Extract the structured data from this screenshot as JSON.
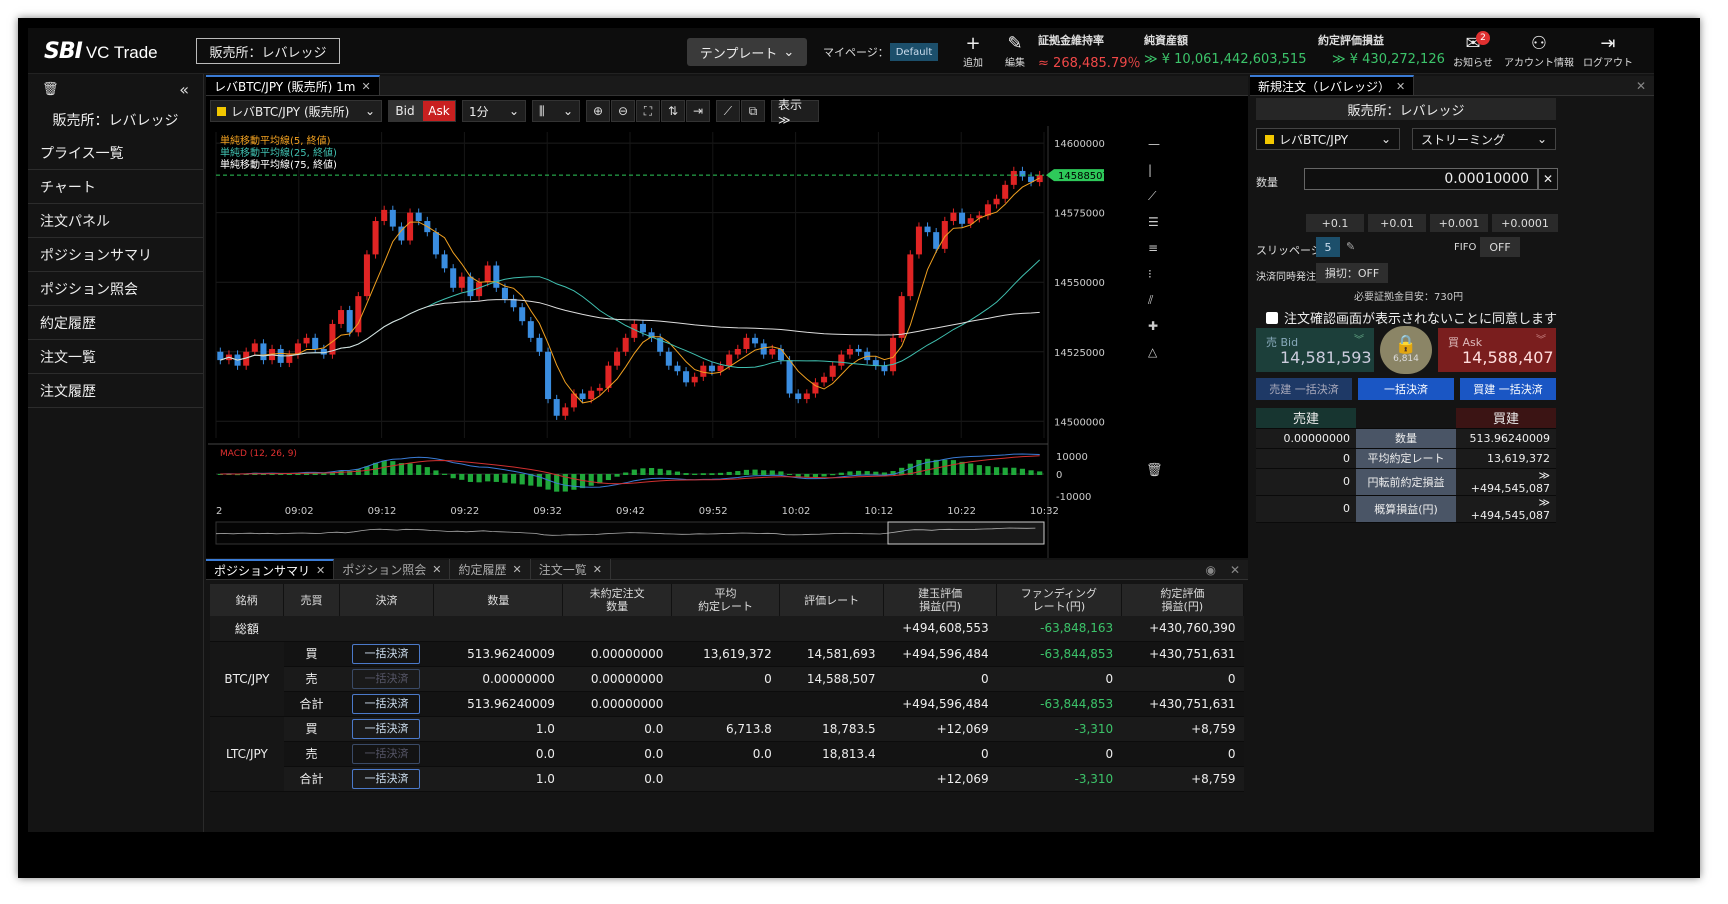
{
  "header": {
    "logo_brand": "SBI",
    "logo_product": "VC Trade",
    "exchange": "販売所：レバレッジ",
    "template": "テンプレート",
    "mypage_label": "マイページ：",
    "mypage_value": "Default",
    "add_label": "追加",
    "edit_label": "編集",
    "stats": [
      {
        "label": "証拠金維持率",
        "value": "268,485.79％",
        "arrow": "≈",
        "color": "red"
      },
      {
        "label": "純資産額",
        "value": "¥ 10,061,442,603,515",
        "arrow": "≫",
        "color": "green"
      },
      {
        "label": "約定評価損益",
        "value": "¥ 430,272,126",
        "arrow": "≫",
        "color": "green"
      }
    ],
    "notice_label": "お知らせ",
    "notice_count": "2",
    "account_label": "アカウント情報",
    "logout_label": "ログアウト"
  },
  "sidebar": {
    "collapse": "«",
    "exchange": "販売所：レバレッジ",
    "items": [
      "プライス一覧",
      "チャート",
      "注文パネル",
      "ポジションサマリ",
      "ポジション照会",
      "約定履歴",
      "注文一覧",
      "注文履歴"
    ]
  },
  "chart_panel": {
    "tab": "レバBTC/JPY (販売所) 1m",
    "symbol": "レバBTC/JPY (販売所)",
    "bid": "Bid",
    "ask": "Ask",
    "interval": "1分",
    "display": "表示 ≫",
    "ma_labels": [
      "単純移動平均線(5, 終値)",
      "単純移動平均線(25, 終値)",
      "単純移動平均線(75, 終値)"
    ],
    "macd_label": "MACD (12, 26, 9)",
    "colors": {
      "up": "#e02424",
      "down": "#3a8de0",
      "ma5": "#f0a020",
      "ma25": "#40c0b0",
      "ma75": "#dddddd"
    }
  },
  "chart_data": {
    "type": "candlestick",
    "price_axis": {
      "ticks": [
        14600000,
        14575000,
        14550000,
        14525000,
        14500000
      ],
      "ylim": [
        14494000,
        14604000
      ]
    },
    "current_price": 14588507,
    "time_ticks": [
      "2",
      "09:02",
      "09:12",
      "09:22",
      "09:32",
      "09:42",
      "09:52",
      "10:02",
      "10:12",
      "10:22",
      "10:32"
    ],
    "macd_axis": {
      "ticks": [
        10000,
        0,
        -10000
      ]
    },
    "closes": [
      14522000,
      14524000,
      14520000,
      14525000,
      14528000,
      14522000,
      14526000,
      14521000,
      14524000,
      14528000,
      14530000,
      14526000,
      14524000,
      14535000,
      14540000,
      14532000,
      14545000,
      14560000,
      14572000,
      14576000,
      14570000,
      14565000,
      14575000,
      14572000,
      14568000,
      14560000,
      14555000,
      14548000,
      14552000,
      14545000,
      14550000,
      14556000,
      14548000,
      14544000,
      14541000,
      14536000,
      14530000,
      14525000,
      14508000,
      14502000,
      14505000,
      14510000,
      14508000,
      14511000,
      14512000,
      14520000,
      14525000,
      14530000,
      14535000,
      14532000,
      14530000,
      14525000,
      14520000,
      14518000,
      14514000,
      14516000,
      14520000,
      14518000,
      14520000,
      14524000,
      14526000,
      14530000,
      14528000,
      14524000,
      14526000,
      14522000,
      14510000,
      14508000,
      14510000,
      14514000,
      14516000,
      14520000,
      14524000,
      14526000,
      14525000,
      14522000,
      14520000,
      14518000,
      14530000,
      14545000,
      14560000,
      14570000,
      14568000,
      14562000,
      14572000,
      14575000,
      14571000,
      14573000,
      14574000,
      14578000,
      14580000,
      14585000,
      14590000,
      14588000,
      14586000,
      14588507
    ]
  },
  "bottom_panel": {
    "tabs": [
      "ポジションサマリ",
      "ポジション照会",
      "約定履歴",
      "注文一覧"
    ],
    "headers": [
      "銘柄",
      "売買",
      "決済",
      "数量",
      "未約定注文\n数量",
      "平均\n約定レート",
      "評価レート",
      "建玉評価\n損益(円)",
      "ファンディング\nレート(円)",
      "約定評価\n損益(円)"
    ],
    "total_label": "総額",
    "total": {
      "tate": "+494,608,553",
      "fund": "-63,848,163",
      "yaku": "+430,760,390"
    },
    "settle_label": "一括決済",
    "groups": [
      {
        "symbol": "BTC/JPY",
        "rows": [
          {
            "side": "買",
            "btn": true,
            "qty": "513.96240009",
            "open": "0.00000000",
            "avg": "13,619,372",
            "rate": "14,581,693",
            "tate": "+494,596,484",
            "fund": "-63,844,853",
            "yaku": "+430,751,631"
          },
          {
            "side": "売",
            "btn": false,
            "qty": "0.00000000",
            "open": "0.00000000",
            "avg": "0",
            "rate": "14,588,507",
            "tate": "0",
            "fund": "0",
            "yaku": "0"
          },
          {
            "side": "合計",
            "btn": true,
            "qty": "513.96240009",
            "open": "0.00000000",
            "avg": "",
            "rate": "",
            "tate": "+494,596,484",
            "fund": "-63,844,853",
            "yaku": "+430,751,631"
          }
        ]
      },
      {
        "symbol": "LTC/JPY",
        "rows": [
          {
            "side": "買",
            "btn": true,
            "qty": "1.0",
            "open": "0.0",
            "avg": "6,713.8",
            "rate": "18,783.5",
            "tate": "+12,069",
            "fund": "-3,310",
            "yaku": "+8,759"
          },
          {
            "side": "売",
            "btn": false,
            "qty": "0.0",
            "open": "0.0",
            "avg": "0.0",
            "rate": "18,813.4",
            "tate": "0",
            "fund": "0",
            "yaku": "0"
          },
          {
            "side": "合計",
            "btn": true,
            "qty": "1.0",
            "open": "0.0",
            "avg": "",
            "rate": "",
            "tate": "+12,069",
            "fund": "-3,310",
            "yaku": "+8,759"
          }
        ]
      }
    ]
  },
  "order_panel": {
    "tab": "新規注文（レバレッジ）",
    "exchange": "販売所：レバレッジ",
    "symbol": "レバBTC/JPY",
    "mode": "ストリーミング",
    "qty_label": "数量",
    "qty_value": "0.00010000",
    "increments": [
      "+0.1",
      "+0.01",
      "+0.001",
      "+0.0001"
    ],
    "slippage_label": "スリッページ",
    "slippage_value": "5",
    "fifo_label": "FIFO",
    "fifo_value": "OFF",
    "simul_label": "決済同時発注",
    "simul_value": "損切：OFF",
    "margin_label": "必要証拠金目安：",
    "margin_value": "730円",
    "confirm_text": "注文確認画面が表示されないことに同意します",
    "sell_label": "売 Bid",
    "sell_price": "14,581,593",
    "buy_label": "買 Ask",
    "buy_price": "14,588,407",
    "spread": "6,814",
    "sell_all": "売建 一括決済",
    "all": "一括決済",
    "buy_all": "買建 一括決済",
    "sell_head": "売建",
    "buy_head": "買建",
    "rows": [
      {
        "sell": "0.00000000",
        "label": "数量",
        "buy": "513.96240009"
      },
      {
        "sell": "0",
        "label": "平均約定レート",
        "buy": "13,619,372"
      },
      {
        "sell": "0",
        "label": "円転前約定損益",
        "buy": "≫ +494,545,087"
      },
      {
        "sell": "0",
        "label": "概算損益(円)",
        "buy": "≫ +494,545,087"
      }
    ]
  }
}
